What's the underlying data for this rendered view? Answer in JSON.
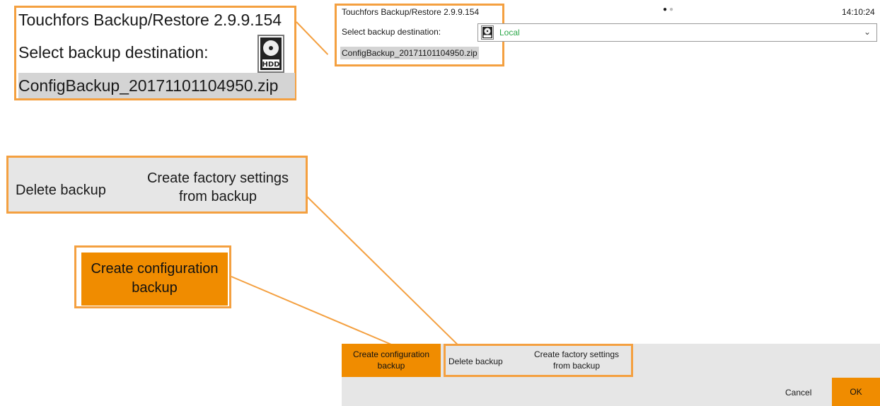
{
  "app": {
    "title": "Touchfors Backup/Restore 2.9.9.154",
    "clock": "14:10:24",
    "page_indicator": {
      "current": 1,
      "total": 2
    }
  },
  "destination": {
    "label": "Select backup destination:",
    "icon": "hdd-icon",
    "value": "Local",
    "value_color": "#2ca84a"
  },
  "backup_file": "ConfigBackup_20171101104950.zip",
  "actions": {
    "create_backup": [
      "Create configuration",
      "backup"
    ],
    "delete_backup": "Delete backup",
    "create_factory": [
      "Create factory settings",
      "from backup"
    ]
  },
  "footer": {
    "cancel": "Cancel",
    "ok": "OK"
  },
  "colors": {
    "accent": "#f08c00",
    "callout": "#f4a040",
    "panel": "#e6e6e6",
    "selection": "#d4d4d4"
  }
}
